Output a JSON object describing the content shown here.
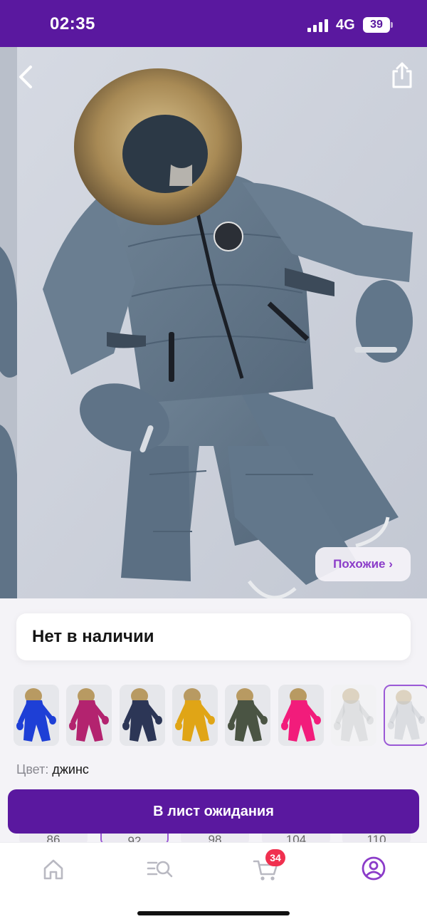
{
  "status_bar": {
    "time": "02:35",
    "network": "4G",
    "battery": "39"
  },
  "photo": {
    "description_icon": "winter-jumpsuit-photo",
    "similar_label": "Похожие ›"
  },
  "availability": {
    "text": "Нет в наличии"
  },
  "color_thumbnails": [
    {
      "color": "#1e3fd6"
    },
    {
      "color": "#b3236f"
    },
    {
      "color": "#2c3656"
    },
    {
      "color": "#e0a516"
    },
    {
      "color": "#4a5443"
    },
    {
      "color": "#f21c7b"
    },
    {
      "color": "#c8c9cd"
    },
    {
      "color": "#bfc3c9"
    }
  ],
  "selected_color": {
    "label": "Цвет:",
    "value": "джинс"
  },
  "sizes": [
    "86",
    "92",
    "98",
    "104",
    "110"
  ],
  "actions": {
    "wait_list": "В лист ожидания"
  },
  "tabbar": {
    "cart_count": "34",
    "accent": "#8b3cc9"
  },
  "colors": {
    "brand": "#5a189f",
    "accent": "#8b3cc9",
    "badge": "#f0304f"
  }
}
